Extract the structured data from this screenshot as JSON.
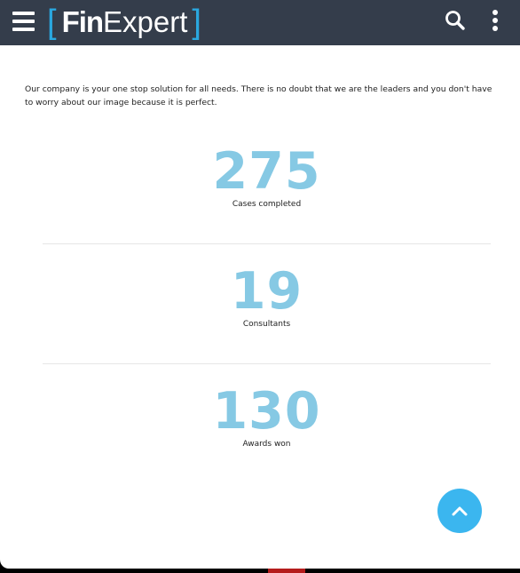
{
  "header": {
    "logo_bracket_left": "[",
    "logo_fin": "Fin",
    "logo_expert": "Expert",
    "logo_bracket_right": "]",
    "menu_icon": "hamburger-icon",
    "search_icon": "search-icon",
    "more_icon": "more-vertical-icon"
  },
  "intro": {
    "text": "Our company is your one stop solution for all needs. There is no doubt that we are the leaders and you don't have to worry about our image because it is perfect."
  },
  "stats": [
    {
      "value": "275",
      "label": "Cases completed"
    },
    {
      "value": "19",
      "label": "Consultants"
    },
    {
      "value": "130",
      "label": "Awards won"
    }
  ],
  "scroll_top": {
    "icon": "chevron-up-icon"
  },
  "colors": {
    "topbar": "#343d4b",
    "accent": "#2aa8e0",
    "stat_number": "#86c9e4",
    "scroll_button": "#3bb6ef"
  }
}
